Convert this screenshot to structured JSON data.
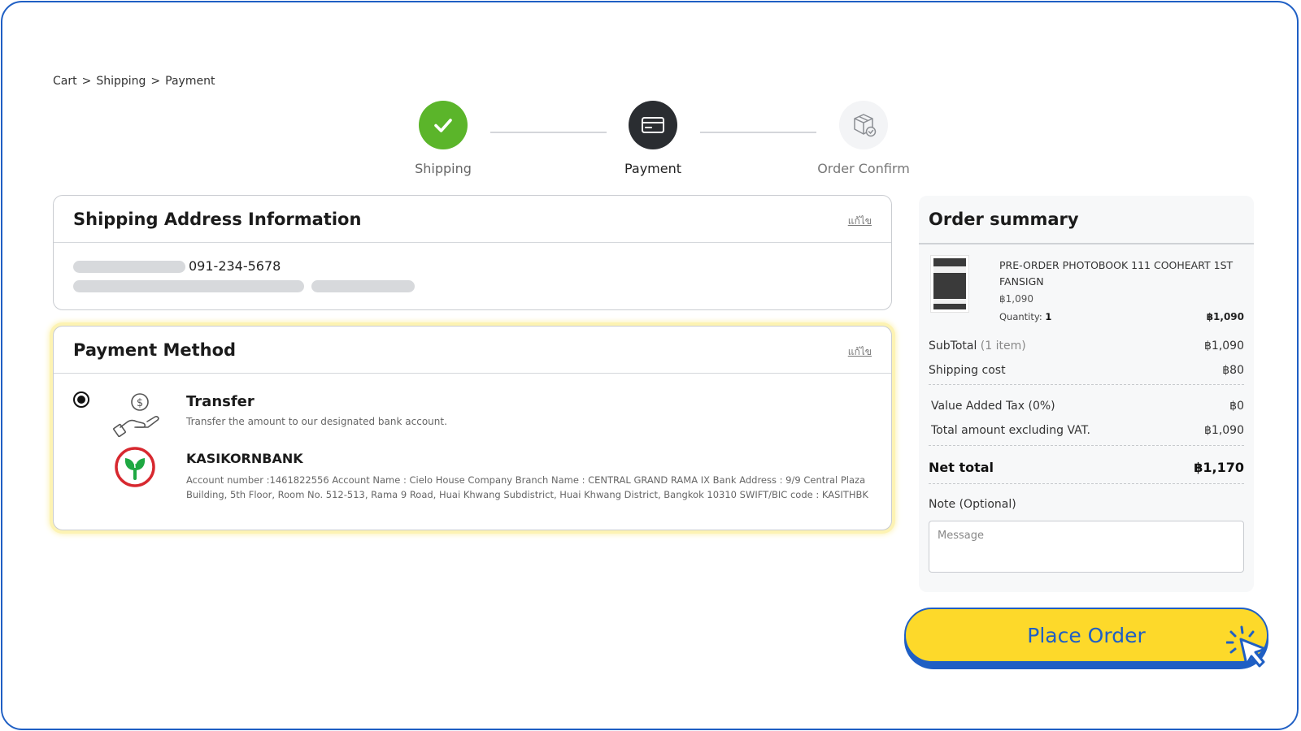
{
  "breadcrumb": [
    "Cart",
    "Shipping",
    "Payment"
  ],
  "breadcrumb_separator": ">",
  "steps": [
    {
      "label": "Shipping",
      "state": "done",
      "icon": "check-icon"
    },
    {
      "label": "Payment",
      "state": "active",
      "icon": "credit-card-icon"
    },
    {
      "label": "Order Confirm",
      "state": "pending",
      "icon": "package-check-icon"
    }
  ],
  "shipping": {
    "title": "Shipping Address Information",
    "edit_label": "แก้ไข",
    "phone": "091-234-5678"
  },
  "payment": {
    "title": "Payment Method",
    "edit_label": "แก้ไข",
    "method_title": "Transfer",
    "method_desc": "Transfer the amount to our designated bank account.",
    "bank_name": "KASIKORNBANK",
    "bank_detail": "Account number :1461822556 Account Name : Cielo House Company Branch Name : CENTRAL GRAND RAMA IX Bank Address : 9/9 Central Plaza Building, 5th Floor, Room No. 512-513, Rama 9 Road, Huai Khwang Subdistrict, Huai Khwang District, Bangkok 10310 SWIFT/BIC code : KASITHBK"
  },
  "summary": {
    "title": "Order summary",
    "product_name": "PRE-ORDER PHOTOBOOK 111 COOHEART 1ST FANSIGN",
    "product_price": "฿1,090",
    "qty_label": "Quantity:",
    "qty_value": "1",
    "product_total": "฿1,090",
    "subtotal_label": "SubTotal",
    "subtotal_count": "(1 item)",
    "subtotal_value": "฿1,090",
    "shipping_label": "Shipping cost",
    "shipping_value": "฿80",
    "vat_label": "Value Added Tax (0%)",
    "vat_value": "฿0",
    "excl_vat_label": "Total amount excluding VAT.",
    "excl_vat_value": "฿1,090",
    "net_label": "Net total",
    "net_value": "฿1,170",
    "note_label": "Note (Optional)",
    "note_placeholder": "Message"
  },
  "place_order_label": "Place Order",
  "colors": {
    "accent_blue": "#1f5fc4",
    "button_yellow": "#fdd92a",
    "success_green": "#5bb52a",
    "kbank_green": "#1ea842",
    "kbank_red": "#d7282f"
  }
}
